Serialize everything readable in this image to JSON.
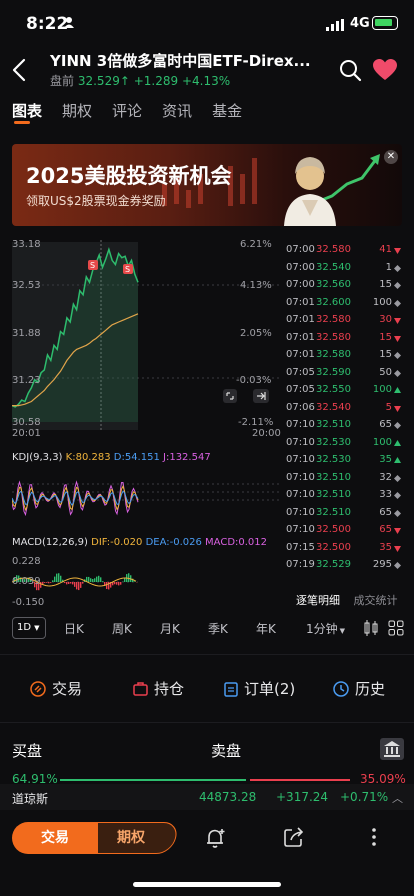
{
  "status_bar": {
    "time": "8:22",
    "network": "4G"
  },
  "header": {
    "title": "YINN 3倍做多富时中国ETF-Direx...",
    "premarket_label": "盘前",
    "price": "32.529",
    "arrow": "↑",
    "change": "+1.289",
    "change_pct": "+4.13%"
  },
  "tabs": [
    "图表",
    "期权",
    "评论",
    "资讯",
    "基金"
  ],
  "banner": {
    "title": "2025美股投资新机会",
    "subtitle": "领取US$2股票现金券奖励"
  },
  "chart": {
    "y_labels": [
      "33.18",
      "32.53",
      "31.88",
      "31.23",
      "30.58"
    ],
    "pct_labels": [
      "6.21%",
      "4.13%",
      "2.05%",
      "-0.03%",
      "-2.11%"
    ],
    "time_start": "20:01",
    "time_end": "20:00",
    "kdj": {
      "name": "KDJ(9,3,3)",
      "k": "K:80.283",
      "d": "D:54.151",
      "j": "J:132.547"
    },
    "macd": {
      "name": "MACD(12,26,9)",
      "dif": "DIF:-0.020",
      "dea": "DEA:-0.026",
      "macd": "MACD:0.012"
    },
    "macd_axis": [
      "0.228",
      "0.039",
      "-0.150"
    ],
    "price_points": [
      30.82,
      30.8,
      30.84,
      30.9,
      30.88,
      31.0,
      31.08,
      31.2,
      31.16,
      31.3,
      31.34,
      31.56,
      31.48,
      31.7,
      31.64,
      31.9,
      31.86,
      32.1,
      32.04,
      32.3,
      32.22,
      32.5,
      32.44,
      32.7,
      32.62,
      32.8,
      32.9,
      33.02,
      32.84,
      32.96,
      33.1,
      32.94,
      32.88,
      33.04,
      32.98,
      33.0,
      32.86,
      32.94,
      32.74,
      32.62
    ],
    "avg_points": [
      30.82,
      30.82,
      30.82,
      30.83,
      30.84,
      30.86,
      30.88,
      30.92,
      30.96,
      31.0,
      31.04,
      31.1,
      31.15,
      31.2,
      31.26,
      31.32,
      31.4,
      31.48,
      31.54,
      31.6,
      31.64,
      31.66,
      31.68,
      31.7,
      31.73,
      31.77,
      31.8,
      31.84,
      31.88,
      31.92,
      31.96,
      32.0,
      32.02,
      32.04,
      32.06,
      32.08,
      32.1,
      32.12,
      32.14,
      32.16
    ]
  },
  "trades": [
    {
      "time": "07:00",
      "price": "32.580",
      "vol": "41",
      "side": "sell"
    },
    {
      "time": "07:00",
      "price": "32.540",
      "vol": "1",
      "side": "neutral"
    },
    {
      "time": "07:00",
      "price": "32.560",
      "vol": "15",
      "side": "neutral"
    },
    {
      "time": "07:01",
      "price": "32.600",
      "vol": "100",
      "side": "neutral"
    },
    {
      "time": "07:01",
      "price": "32.580",
      "vol": "30",
      "side": "sell"
    },
    {
      "time": "07:01",
      "price": "32.580",
      "vol": "15",
      "side": "sell"
    },
    {
      "time": "07:01",
      "price": "32.580",
      "vol": "15",
      "side": "neutral"
    },
    {
      "time": "07:05",
      "price": "32.590",
      "vol": "50",
      "side": "neutral"
    },
    {
      "time": "07:05",
      "price": "32.550",
      "vol": "100",
      "side": "buy"
    },
    {
      "time": "07:06",
      "price": "32.540",
      "vol": "5",
      "side": "sell"
    },
    {
      "time": "07:10",
      "price": "32.510",
      "vol": "65",
      "side": "neutral"
    },
    {
      "time": "07:10",
      "price": "32.530",
      "vol": "100",
      "side": "buy"
    },
    {
      "time": "07:10",
      "price": "32.530",
      "vol": "35",
      "side": "buy"
    },
    {
      "time": "07:10",
      "price": "32.510",
      "vol": "32",
      "side": "neutral"
    },
    {
      "time": "07:10",
      "price": "32.510",
      "vol": "33",
      "side": "neutral"
    },
    {
      "time": "07:10",
      "price": "32.510",
      "vol": "65",
      "side": "neutral"
    },
    {
      "time": "07:10",
      "price": "32.500",
      "vol": "65",
      "side": "sell"
    },
    {
      "time": "07:15",
      "price": "32.500",
      "vol": "35",
      "side": "sell"
    },
    {
      "time": "07:19",
      "price": "32.529",
      "vol": "295",
      "side": "neutral"
    }
  ],
  "trades_tabs": {
    "detail": "逐笔明细",
    "stats": "成交统计"
  },
  "periods": {
    "selected": "1D",
    "items": [
      "日K",
      "周K",
      "月K",
      "季K",
      "年K",
      "1分钟"
    ]
  },
  "actions": {
    "trade": "交易",
    "position": "持仓",
    "orders": "订单(2)",
    "history": "历史"
  },
  "orderbook": {
    "buy": "买盘",
    "sell": "卖盘",
    "buy_pct": "64.91%",
    "sell_pct": "35.09%"
  },
  "index": {
    "name": "道琼斯",
    "value": "44873.28",
    "change": "+317.24",
    "pct": "+0.71%"
  },
  "bottom": {
    "trade": "交易",
    "options": "期权"
  },
  "colors": {
    "accent": "#f26b1d",
    "up": "#2ebd6e",
    "down": "#ea3f4e"
  }
}
